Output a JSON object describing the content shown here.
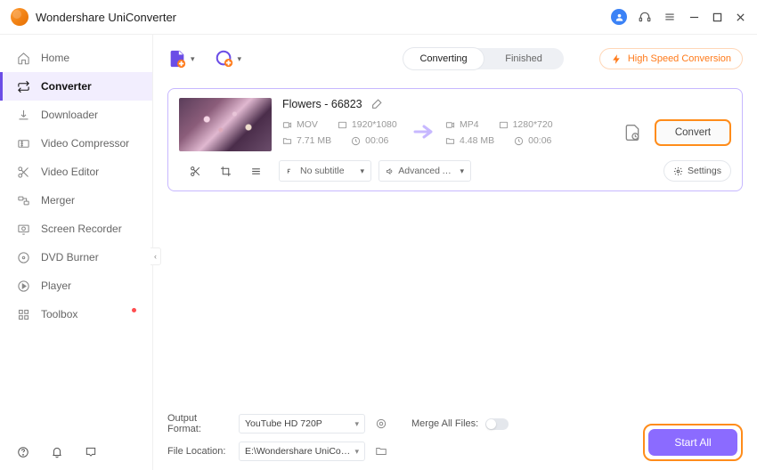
{
  "app_title": "Wondershare UniConverter",
  "sidebar": {
    "items": [
      {
        "label": "Home"
      },
      {
        "label": "Converter"
      },
      {
        "label": "Downloader"
      },
      {
        "label": "Video Compressor"
      },
      {
        "label": "Video Editor"
      },
      {
        "label": "Merger"
      },
      {
        "label": "Screen Recorder"
      },
      {
        "label": "DVD Burner"
      },
      {
        "label": "Player"
      },
      {
        "label": "Toolbox"
      }
    ]
  },
  "tabs": {
    "converting": "Converting",
    "finished": "Finished"
  },
  "highspeed_label": "High Speed Conversion",
  "item": {
    "title": "Flowers - 66823",
    "src_format": "MOV",
    "src_res": "1920*1080",
    "src_size": "7.71 MB",
    "src_dur": "00:06",
    "dst_format": "MP4",
    "dst_res": "1280*720",
    "dst_size": "4.48 MB",
    "dst_dur": "00:06",
    "convert_label": "Convert",
    "subtitle_label": "No subtitle",
    "audio_label": "Advanced Aud...",
    "settings_label": "Settings"
  },
  "footer": {
    "output_format_label": "Output Format:",
    "output_format_value": "YouTube HD 720P",
    "file_location_label": "File Location:",
    "file_location_value": "E:\\Wondershare UniConverter",
    "merge_label": "Merge All Files:",
    "start_all": "Start All"
  }
}
